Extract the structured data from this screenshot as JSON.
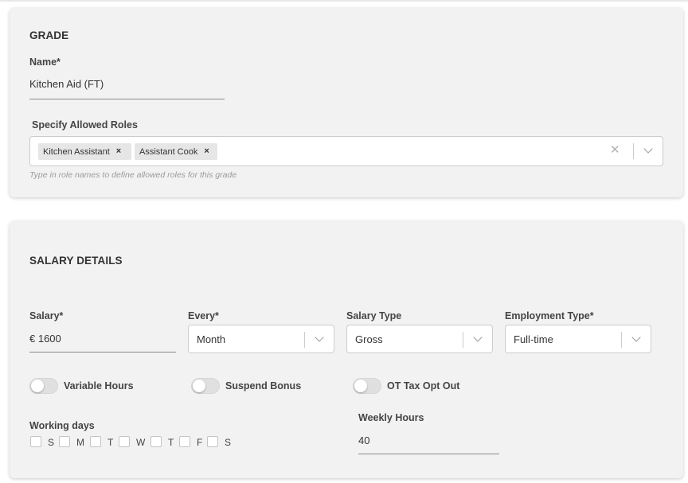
{
  "grade": {
    "section_title": "GRADE",
    "name_label": "Name*",
    "name_value": "Kitchen Aid (FT)",
    "roles_label": "Specify Allowed Roles",
    "roles": [
      {
        "label": "Kitchen Assistant"
      },
      {
        "label": "Assistant Cook"
      }
    ],
    "chip_remove_glyph": "×",
    "clear_glyph": "✕",
    "roles_helper": "Type in role names to define allowed roles for this grade"
  },
  "salary": {
    "section_title": "SALARY DETAILS",
    "salary_label": "Salary*",
    "salary_value": "€ 1600",
    "every_label": "Every*",
    "every_value": "Month",
    "salary_type_label": "Salary Type",
    "salary_type_value": "Gross",
    "employment_type_label": "Employment Type*",
    "employment_type_value": "Full-time",
    "toggles": [
      {
        "label": "Variable Hours",
        "on": false
      },
      {
        "label": "Suspend Bonus",
        "on": false
      },
      {
        "label": "OT Tax Opt Out",
        "on": false
      }
    ],
    "working_days_label": "Working days",
    "days": [
      "S",
      "M",
      "T",
      "W",
      "T",
      "F",
      "S"
    ],
    "weekly_hours_label": "Weekly Hours",
    "weekly_hours_value": "40"
  },
  "colors": {
    "card_bg": "#f2f2f2",
    "input_border": "#cccccc",
    "chip_bg": "#e6e6e6"
  }
}
